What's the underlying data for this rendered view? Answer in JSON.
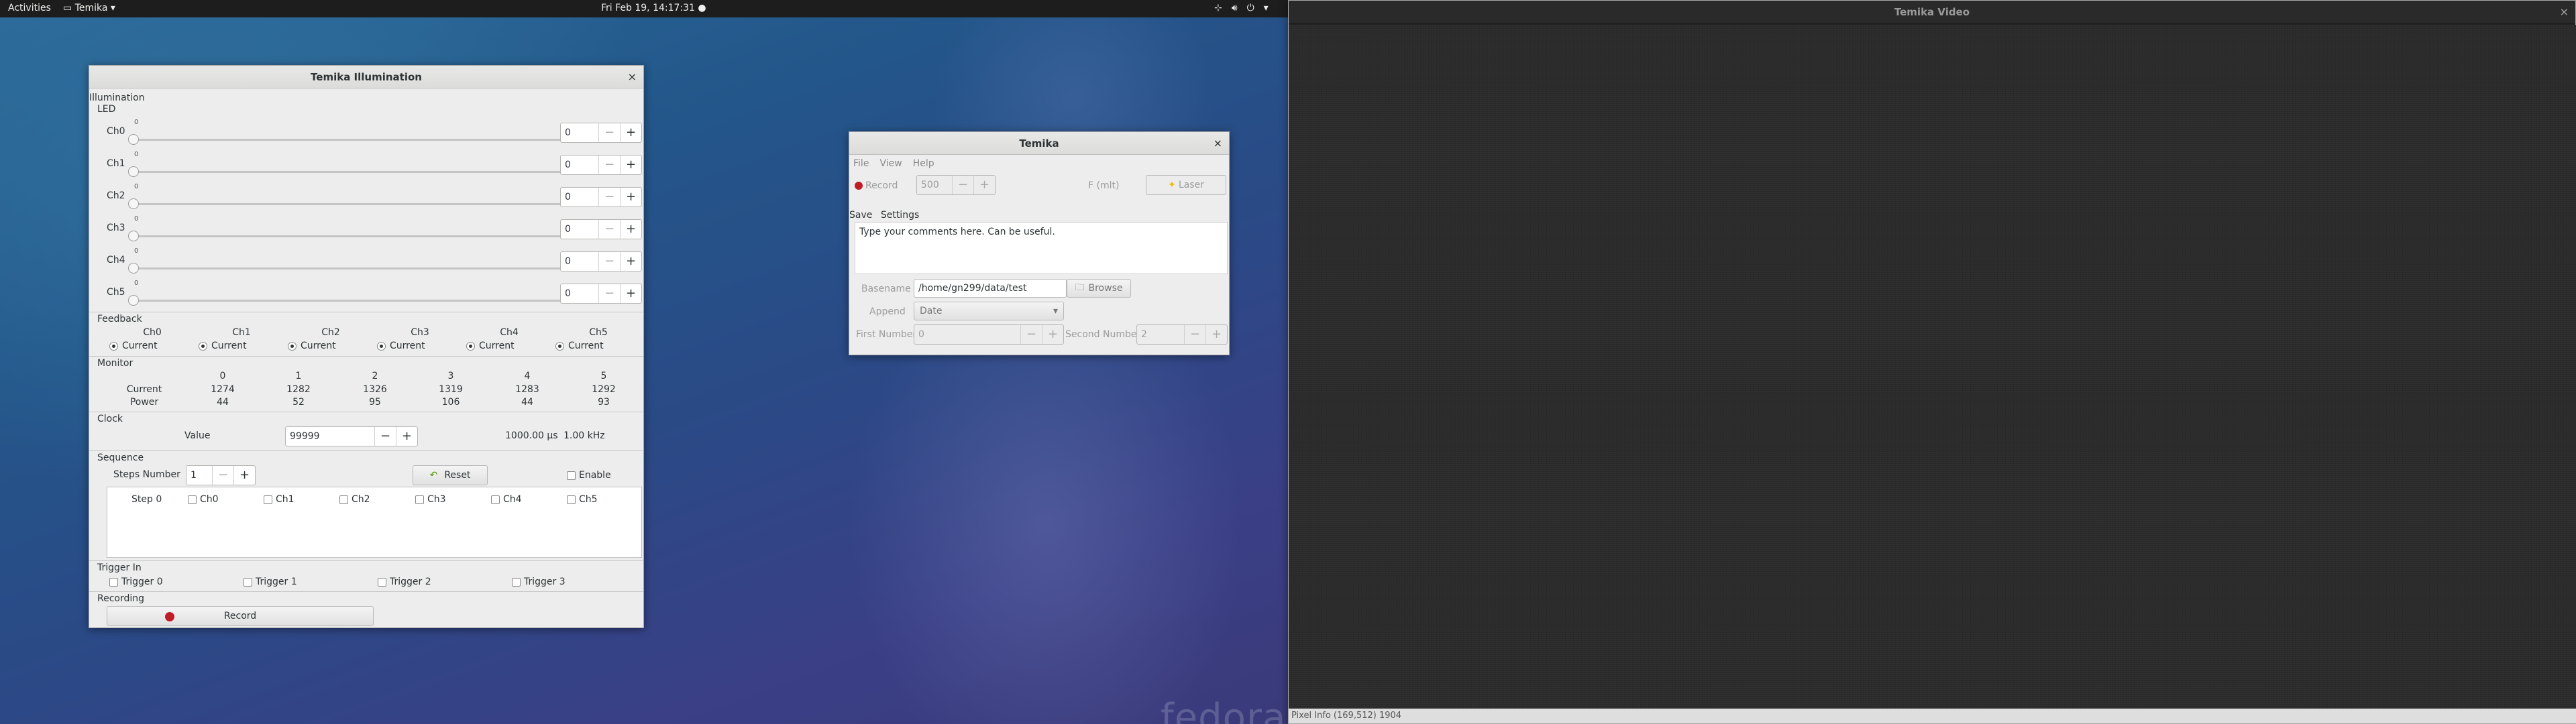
{
  "topbar": {
    "activities": "Activities",
    "app_menu": "Temika",
    "clock": "Fri Feb 19, 14:17:31",
    "icons": [
      "network-icon",
      "volume-icon",
      "power-icon",
      "chevron-down-icon"
    ]
  },
  "illumination": {
    "title": "Temika Illumination",
    "section_label": "Illumination",
    "led": {
      "label": "LED",
      "channels": [
        {
          "name": "Ch0",
          "tick": "0",
          "value": "0"
        },
        {
          "name": "Ch1",
          "tick": "0",
          "value": "0"
        },
        {
          "name": "Ch2",
          "tick": "0",
          "value": "0"
        },
        {
          "name": "Ch3",
          "tick": "0",
          "value": "0"
        },
        {
          "name": "Ch4",
          "tick": "0",
          "value": "0"
        },
        {
          "name": "Ch5",
          "tick": "0",
          "value": "0"
        }
      ]
    },
    "feedback": {
      "label": "Feedback",
      "channels": [
        "Ch0",
        "Ch1",
        "Ch2",
        "Ch3",
        "Ch4",
        "Ch5"
      ],
      "option": "Current"
    },
    "monitor": {
      "label": "Monitor",
      "columns": [
        "0",
        "1",
        "2",
        "3",
        "4",
        "5"
      ],
      "rows": [
        {
          "name": "Current",
          "values": [
            "1274",
            "1282",
            "1326",
            "1319",
            "1283",
            "1292"
          ]
        },
        {
          "name": "Power",
          "values": [
            "44",
            "52",
            "95",
            "106",
            "44",
            "93"
          ]
        }
      ]
    },
    "clock": {
      "label": "Clock",
      "value_label": "Value",
      "value": "99999",
      "period": "1000.00 µs",
      "frequency": "1.00 kHz"
    },
    "sequence": {
      "label": "Sequence",
      "steps_label": "Steps Number",
      "steps_value": "1",
      "reset_label": "Reset",
      "enable_label": "Enable",
      "step_label": "Step 0",
      "channels": [
        "Ch0",
        "Ch1",
        "Ch2",
        "Ch3",
        "Ch4",
        "Ch5"
      ]
    },
    "trigger_in": {
      "label": "Trigger In",
      "triggers": [
        "Trigger 0",
        "Trigger 1",
        "Trigger 2",
        "Trigger 3"
      ]
    },
    "recording": {
      "label": "Recording",
      "record_label": "Record"
    }
  },
  "temika": {
    "title": "Temika",
    "menu": [
      "File",
      "View",
      "Help"
    ],
    "record_label": "Record",
    "frames_value": "500",
    "fps_label": "F (mlt)",
    "laser_label": "Laser",
    "tabs": [
      "Save",
      "Settings"
    ],
    "comment": "Type your comments here. Can be useful.",
    "basename_label": "Basename",
    "basename_value": "/home/gn299/data/test",
    "browse_label": "Browse",
    "append_label": "Append",
    "append_value": "Date",
    "first_number_label": "First Number",
    "first_number_value": "0",
    "second_number_label": "Second Number",
    "second_number_value": "2"
  },
  "video": {
    "title": "Temika Video",
    "status": "Pixel Info (169,512) 1904"
  },
  "wallpaper_logo": "fedora",
  "colors": {
    "record_red": "#c01c28",
    "reset_green": "#4e9a06",
    "topbar": "#1d1d1d"
  }
}
